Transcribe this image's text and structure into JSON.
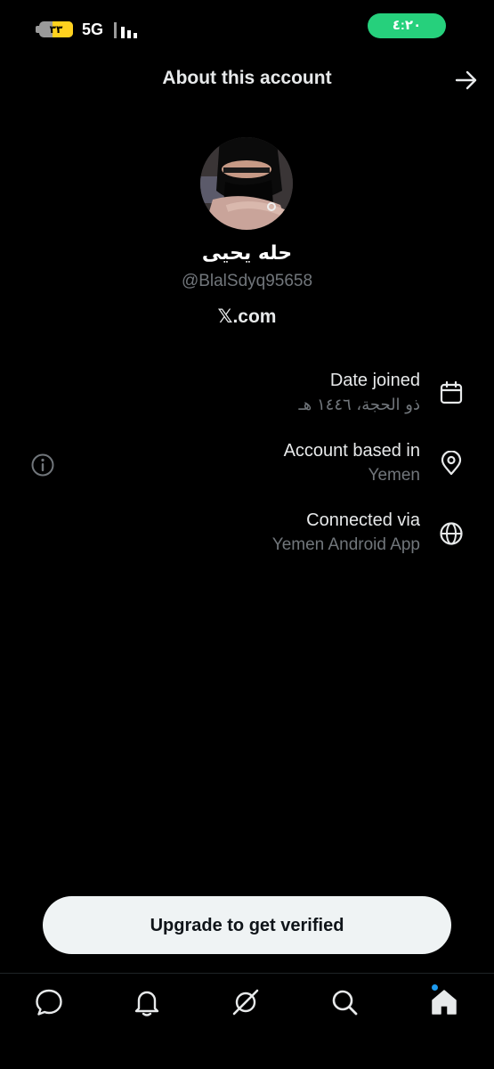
{
  "status_bar": {
    "battery": "٣٣",
    "network": "5G",
    "time": "٤:٢٠"
  },
  "header": {
    "title": "About this account",
    "forward_icon": "arrow-right-icon"
  },
  "profile": {
    "name": "حله يحيى",
    "handle": "@BlalSdyq95658",
    "site": "𝕏.com"
  },
  "details": {
    "date_joined": {
      "label": "Date joined",
      "value": "ذو الحجة، ١٤٤٦ هـ",
      "icon": "calendar-icon"
    },
    "account_based": {
      "label": "Account based in",
      "value": "Yemen",
      "icon": "location-pin-icon"
    },
    "connected_via": {
      "label": "Connected via",
      "value": "Yemen Android App",
      "icon": "globe-icon"
    },
    "info_icon": "info-icon"
  },
  "upgrade_button": {
    "label": "Upgrade to get verified"
  },
  "bottom_nav": {
    "items": [
      "chat-icon",
      "bell-icon",
      "grok-icon",
      "search-icon",
      "home-icon"
    ],
    "notification_dot_color": "#1d9bf0"
  },
  "colors": {
    "background": "#000000",
    "primary_text": "#e7e9ea",
    "secondary_text": "#71767b",
    "clock_pill": "#26d07c",
    "button_bg": "#eff3f4"
  }
}
